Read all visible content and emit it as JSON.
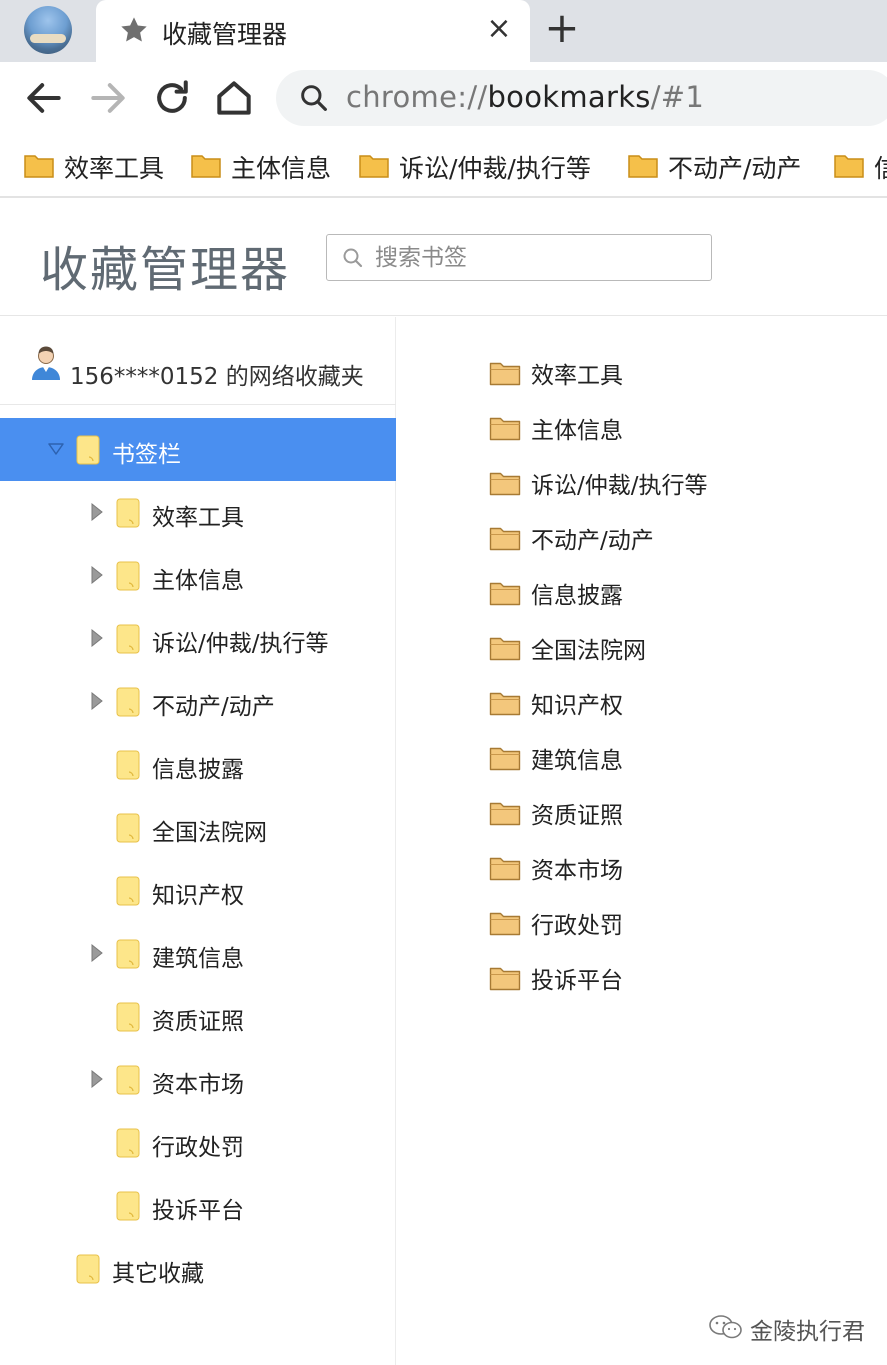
{
  "tab": {
    "title": "收藏管理器",
    "close_glyph": "×",
    "new_tab_glyph": "+"
  },
  "toolbar": {
    "back_icon": "back-arrow-icon",
    "forward_icon": "forward-arrow-icon",
    "reload_icon": "reload-icon",
    "home_icon": "home-icon",
    "url_scheme": "chrome://",
    "url_host": "bookmarks",
    "url_rest": "/#1"
  },
  "bookmarks_bar": {
    "items": [
      {
        "label": "效率工具"
      },
      {
        "label": "主体信息"
      },
      {
        "label": "诉讼/仲裁/执行等"
      },
      {
        "label": "不动产/动产"
      },
      {
        "label": "信"
      }
    ]
  },
  "manager": {
    "title": "收藏管理器",
    "search_placeholder": "搜索书签"
  },
  "tree": {
    "account_label": "156****0152 的网络收藏夹",
    "root": {
      "label": "书签栏",
      "expanded": true,
      "selected": true
    },
    "children": [
      {
        "label": "效率工具",
        "has_children": true
      },
      {
        "label": "主体信息",
        "has_children": true
      },
      {
        "label": "诉讼/仲裁/执行等",
        "has_children": true
      },
      {
        "label": "不动产/动产",
        "has_children": true
      },
      {
        "label": "信息披露",
        "has_children": false
      },
      {
        "label": "全国法院网",
        "has_children": false
      },
      {
        "label": "知识产权",
        "has_children": false
      },
      {
        "label": "建筑信息",
        "has_children": true
      },
      {
        "label": "资质证照",
        "has_children": false
      },
      {
        "label": "资本市场",
        "has_children": true
      },
      {
        "label": "行政处罚",
        "has_children": false
      },
      {
        "label": "投诉平台",
        "has_children": false
      }
    ],
    "other": {
      "label": "其它收藏"
    }
  },
  "list": {
    "items": [
      {
        "label": "效率工具"
      },
      {
        "label": "主体信息"
      },
      {
        "label": "诉讼/仲裁/执行等"
      },
      {
        "label": "不动产/动产"
      },
      {
        "label": "信息披露"
      },
      {
        "label": "全国法院网"
      },
      {
        "label": "知识产权"
      },
      {
        "label": "建筑信息"
      },
      {
        "label": "资质证照"
      },
      {
        "label": "资本市场"
      },
      {
        "label": "行政处罚"
      },
      {
        "label": "投诉平台"
      }
    ]
  },
  "watermark": {
    "text": "金陵执行君"
  },
  "colors": {
    "tabstrip_bg": "#dee1e6",
    "selected_row": "#4a8ff0",
    "tree_folder": "#fde68a",
    "list_folder": "#e8b25e",
    "bar_folder": "#f5c04a"
  }
}
